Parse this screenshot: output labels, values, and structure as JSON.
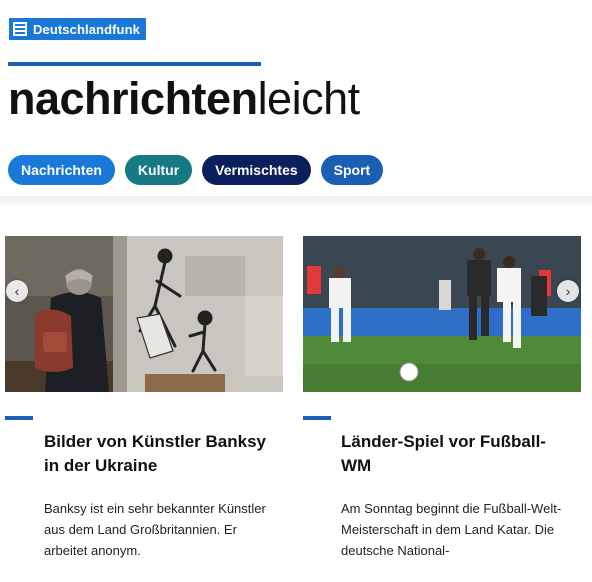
{
  "brand": {
    "name": "Deutschlandfunk",
    "icon": "document-lines-icon"
  },
  "title": {
    "bold": "nachrichten",
    "light": "leicht"
  },
  "nav": [
    {
      "label": "Nachrichten",
      "color": "#1a78d8"
    },
    {
      "label": "Kultur",
      "color": "#157a83"
    },
    {
      "label": "Vermischtes",
      "color": "#0b1f5c"
    },
    {
      "label": "Sport",
      "color": "#1a5fb4"
    }
  ],
  "carousel": {
    "prev_icon": "chevron-left-icon",
    "next_icon": "chevron-right-icon"
  },
  "articles": [
    {
      "headline": "Bilder von Künstler Banksy in der Ukraine",
      "teaser": "Banksy ist ein sehr bekannter Künstler aus dem Land Großbritannien. Er arbeitet anonym."
    },
    {
      "headline": "Länder-Spiel vor Fußball-WM",
      "teaser": "Am Sonntag beginnt die Fußball-Welt-Meisterschaft in dem Land Katar. Die deutsche National-"
    }
  ]
}
